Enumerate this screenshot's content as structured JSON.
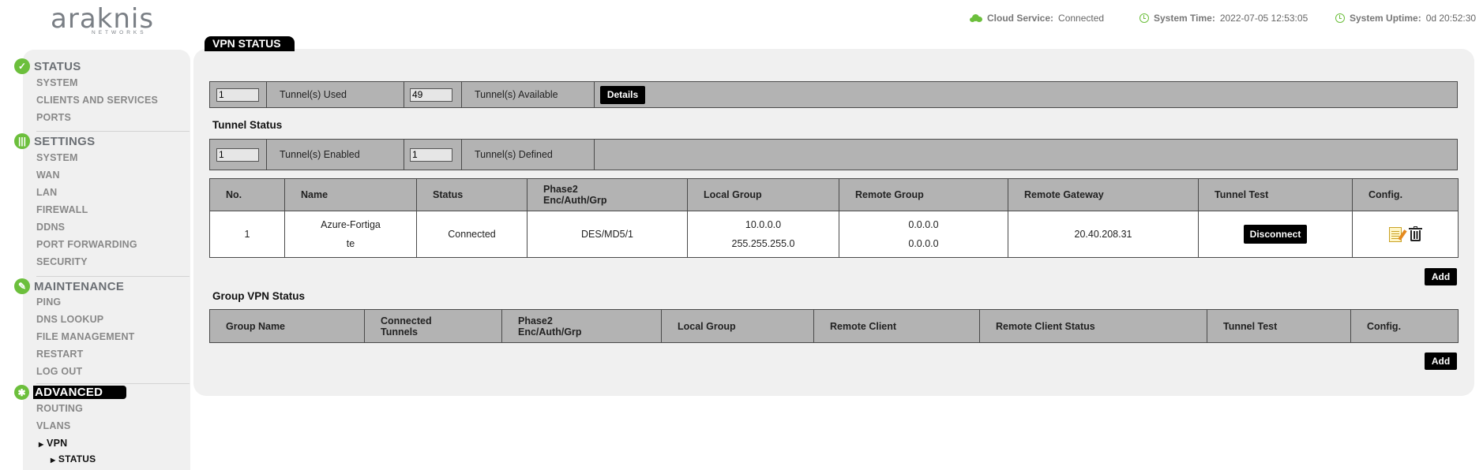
{
  "brand": {
    "name": "araknis",
    "sub": "NETWORKS"
  },
  "header": {
    "cloud_label": "Cloud Service:",
    "cloud_value": "Connected",
    "time_label": "System Time:",
    "time_value": "2022-07-05 12:53:05",
    "uptime_label": "System Uptime:",
    "uptime_value": "0d 20:52:30"
  },
  "sidebar": {
    "status": {
      "title": "STATUS",
      "items": [
        "SYSTEM",
        "CLIENTS AND SERVICES",
        "PORTS"
      ]
    },
    "settings": {
      "title": "SETTINGS",
      "items": [
        "SYSTEM",
        "WAN",
        "LAN",
        "FIREWALL",
        "DDNS",
        "PORT FORWARDING",
        "SECURITY"
      ]
    },
    "maintenance": {
      "title": "MAINTENANCE",
      "items": [
        "PING",
        "DNS LOOKUP",
        "FILE MANAGEMENT",
        "RESTART",
        "LOG OUT"
      ]
    },
    "advanced": {
      "title": "ADVANCED",
      "items": [
        "ROUTING",
        "VLANS",
        "VPN",
        "STATUS"
      ]
    }
  },
  "page": {
    "tab": "VPN STATUS"
  },
  "summary": {
    "used_value": "1",
    "used_label": "Tunnel(s) Used",
    "available_value": "49",
    "available_label": "Tunnel(s) Available",
    "details_button": "Details"
  },
  "tunnel_status": {
    "title": "Tunnel Status",
    "enabled_value": "1",
    "enabled_label": "Tunnel(s) Enabled",
    "defined_value": "1",
    "defined_label": "Tunnel(s) Defined",
    "columns": [
      "No.",
      "Name",
      "Status",
      "Phase2",
      "Enc/Auth/Grp",
      "Local Group",
      "Remote Group",
      "Remote Gateway",
      "Tunnel Test",
      "Config."
    ],
    "row": {
      "no": "1",
      "name_1": "Azure-Fortiga",
      "name_2": "te",
      "status": "Connected",
      "phase2": "DES/MD5/1",
      "local_1": "10.0.0.0",
      "local_2": "255.255.255.0",
      "remote_1": "0.0.0.0",
      "remote_2": "0.0.0.0",
      "gateway": "20.40.208.31",
      "test_button": "Disconnect"
    },
    "add_button": "Add"
  },
  "group_vpn": {
    "title": "Group VPN Status",
    "columns": [
      "Group Name",
      "Connected",
      "Tunnels",
      "Phase2",
      "Enc/Auth/Grp",
      "Local Group",
      "Remote Client",
      "Remote Client Status",
      "Tunnel Test",
      "Config."
    ],
    "add_button": "Add"
  },
  "colors": {
    "accent": "#6cbf3c",
    "header_cell": "#b3b3b3",
    "panel": "#f0f0f0"
  }
}
